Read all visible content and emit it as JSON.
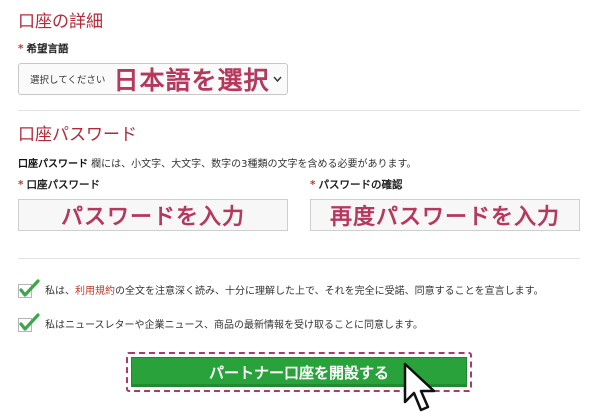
{
  "account_details": {
    "title": "口座の詳細",
    "language_label": "希望言語",
    "required_mark": "*",
    "language_select_placeholder": "選択してください",
    "language_overlay": "日本語を選択"
  },
  "password_section": {
    "title": "口座パスワード",
    "description_bold": "口座パスワード",
    "description_rest": " 欄には、小文字、大文字、数字の3種類の文字を含める必要があります。",
    "password_label": "口座パスワード",
    "confirm_label": "パスワードの確認",
    "password_overlay": "パスワードを入力",
    "confirm_overlay": "再度パスワードを入力"
  },
  "agreements": {
    "terms_prefix": "私は、",
    "terms_link": "利用規約",
    "terms_suffix": "の全文を注意深く読み、十分に理解した上で、それを完全に受諾、同意することを宣言します。",
    "newsletter": "私はニュースレターや企業ニュース、商品の最新情報を受け取ることに同意します。",
    "terms_checked": true,
    "newsletter_checked": true
  },
  "submit": {
    "label": "パートナー口座を開設する"
  },
  "colors": {
    "section_title": "#b22a3a",
    "overlay_text": "#b5385e",
    "button": "#2aa23c",
    "check": "#3aa84a"
  },
  "icons": {
    "check": "check-icon",
    "chevron": "chevron-down-icon",
    "cursor": "mouse-pointer-icon"
  }
}
